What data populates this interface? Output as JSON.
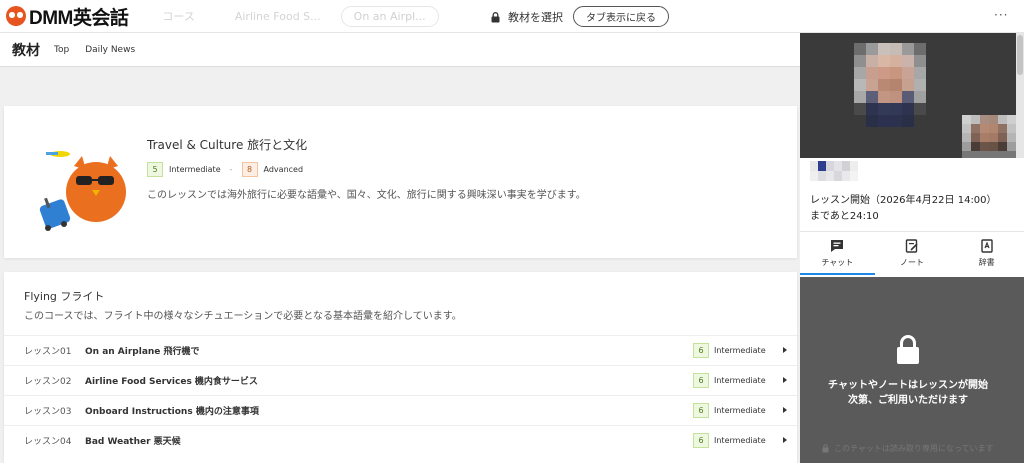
{
  "brand": {
    "name": "DMM英会話",
    "accent": "#e8541f"
  },
  "topbar": {
    "ghost_items": [
      "コース",
      "Airline Food S...",
      "On an Airpl..."
    ],
    "lock_label": "教材を選択",
    "tab_button": "タブ表示に戻る",
    "more": "···"
  },
  "subnav": {
    "title": "教材",
    "links": [
      "Top",
      "Daily News"
    ]
  },
  "hero": {
    "title": "Travel & Culture 旅行と文化",
    "level_from": {
      "num": "5",
      "label": "Intermediate"
    },
    "level_to": {
      "num": "8",
      "label": "Advanced"
    },
    "dash": "-",
    "description": "このレッスンでは海外旅行に必要な語彙や、国々、文化、旅行に関する興味深い事実を学びます。"
  },
  "course": {
    "title": "Flying フライト",
    "description": "このコースでは、フライト中の様々なシチュエーションで必要となる基本語彙を紹介しています。",
    "lessons": [
      {
        "num": "レッスン01",
        "name": "On an Airplane 飛行機で",
        "level": "6",
        "level_label": "Intermediate"
      },
      {
        "num": "レッスン02",
        "name": "Airline Food Services 機内食サービス",
        "level": "6",
        "level_label": "Intermediate"
      },
      {
        "num": "レッスン03",
        "name": "Onboard Instructions 機内の注意事項",
        "level": "6",
        "level_label": "Intermediate"
      },
      {
        "num": "レッスン04",
        "name": "Bad Weather 悪天候",
        "level": "6",
        "level_label": "Intermediate"
      }
    ]
  },
  "panel": {
    "lesson_start": "レッスン開始（2026年4月22日 14:00）",
    "remaining": "まであと24:10",
    "tabs": [
      "チャット",
      "ノート",
      "辞書"
    ],
    "chat_message_1": "チャットやノートはレッスンが開始",
    "chat_message_2": "次第、ご利用いただけます",
    "chat_note": "このチャットは読み取り専用になっています"
  }
}
